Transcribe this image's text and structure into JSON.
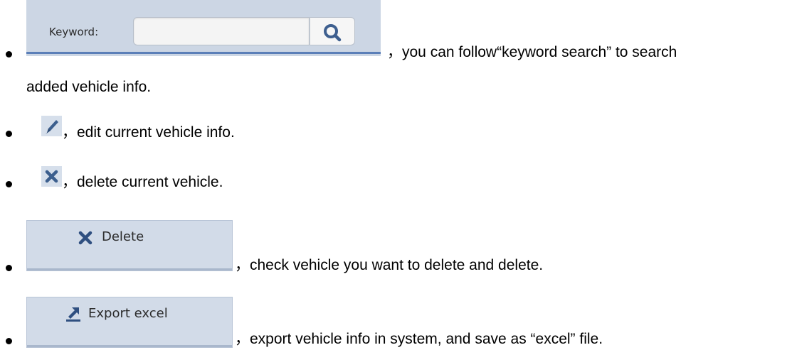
{
  "items": [
    {
      "widget": {
        "label": "Keyword:",
        "input_value": "",
        "search_icon": "search-icon"
      },
      "text_line1": "，you can follow“keyword search” to search",
      "text_line2": "added vehicle info."
    },
    {
      "icon": "pencil-icon",
      "text": "，edit current vehicle info."
    },
    {
      "icon": "close-icon",
      "text": "，delete current vehicle."
    },
    {
      "button": {
        "label": "Delete",
        "icon": "close-icon"
      },
      "text": "，check vehicle you want to delete and delete."
    },
    {
      "button": {
        "label": "Export excel",
        "icon": "export-icon"
      },
      "text": "，export vehicle info in system, and save as “excel” file."
    }
  ],
  "colors": {
    "widget_bg": "#ccd6e4",
    "accent_blue": "#5b7fb8",
    "icon_tile_bg": "#d6dfeb",
    "button_bg": "#d2dbe8",
    "text": "#000000"
  }
}
